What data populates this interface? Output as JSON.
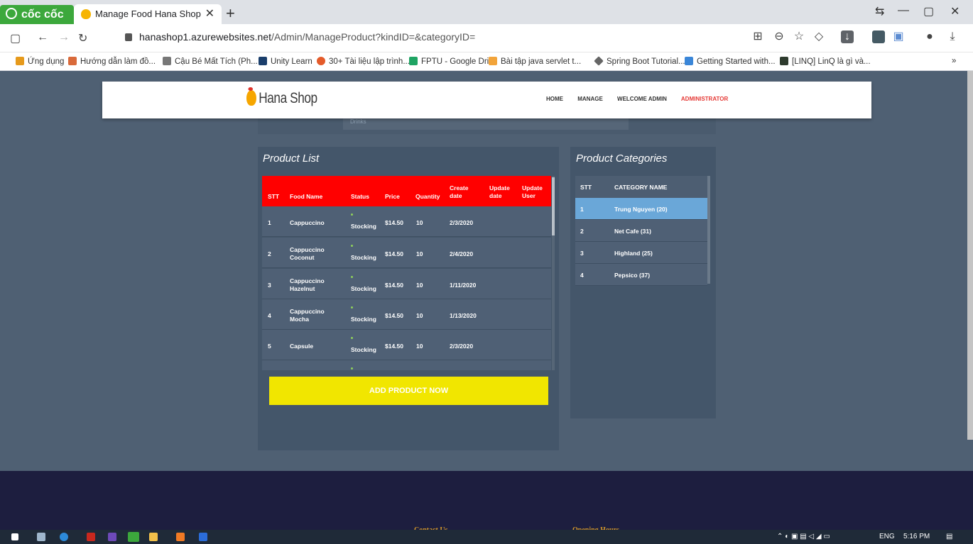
{
  "browser": {
    "brand": "cốc cốc",
    "tab_title": "Manage Food Hana Shop",
    "url_host": "hanashop1.azurewebsites.net",
    "url_path": "/Admin/ManageProduct?kindID=&categoryID=",
    "bookmarks": [
      "Ứng dụng",
      "Hướng dẫn làm đồ...",
      "Cậu Bé Mất Tích (Ph...",
      "Unity Learn",
      "30+ Tài liệu lập trình...",
      "FPTU - Google Drive",
      "Bài tập java servlet t...",
      "Spring Boot Tutorial...",
      "Getting Started with...",
      "[LINQ] LinQ là gì và..."
    ],
    "bookmarks_more": "»"
  },
  "site": {
    "logo": "Hana Shop",
    "nav": {
      "home": "HOME",
      "manage": "MANAGE",
      "welcome": "WELCOME ADMIN",
      "user": "ADMINISTRATOR"
    },
    "filter_value": "Drinks"
  },
  "product_panel": {
    "title": "Product List",
    "headers": {
      "stt": "STT",
      "food_name": "Food Name",
      "status": "Status",
      "price": "Price",
      "quantity": "Quantity",
      "create_date": "Create date",
      "update_date": "Update date",
      "update_user": "Update User"
    },
    "rows": [
      {
        "stt": "1",
        "name": "Cappuccino",
        "status": "Stocking",
        "price": "$14.50",
        "qty": "10",
        "created": "2/3/2020"
      },
      {
        "stt": "2",
        "name": "Cappuccino Coconut",
        "status": "Stocking",
        "price": "$14.50",
        "qty": "10",
        "created": "2/4/2020"
      },
      {
        "stt": "3",
        "name": "Cappuccino Hazelnut",
        "status": "Stocking",
        "price": "$14.50",
        "qty": "10",
        "created": "1/11/2020"
      },
      {
        "stt": "4",
        "name": "Cappuccino Mocha",
        "status": "Stocking",
        "price": "$14.50",
        "qty": "10",
        "created": "1/13/2020"
      },
      {
        "stt": "5",
        "name": "Capsule",
        "status": "Stocking",
        "price": "$14.50",
        "qty": "10",
        "created": "2/3/2020"
      }
    ],
    "add_button": "ADD PRODUCT NOW"
  },
  "category_panel": {
    "title": "Product Categories",
    "headers": {
      "stt": "STT",
      "name": "CATEGORY NAME"
    },
    "rows": [
      {
        "stt": "1",
        "name": "Trung Nguyen (20)"
      },
      {
        "stt": "2",
        "name": "Net Cafe (31)"
      },
      {
        "stt": "3",
        "name": "Highland (25)"
      },
      {
        "stt": "4",
        "name": "Pepsico (37)"
      }
    ]
  },
  "footer": {
    "contact": "Contact Us",
    "hours": "Opening Hours"
  },
  "taskbar": {
    "lang": "ENG",
    "time": "5:16 PM"
  },
  "colors": {
    "page_bg": "#4f6073",
    "table_header": "#ff0000",
    "add_button": "#f1e600",
    "active_category": "#6aa7d8",
    "admin_name": "#e53935"
  }
}
